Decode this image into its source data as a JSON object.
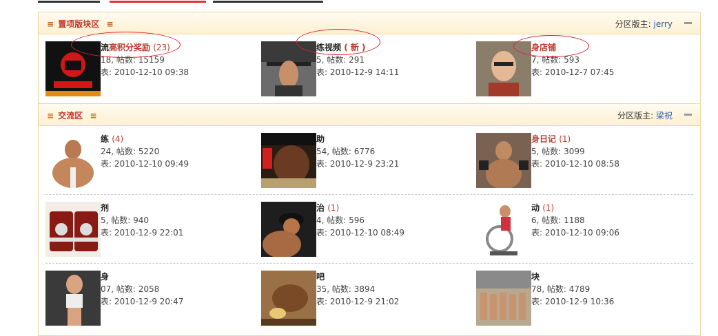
{
  "sections": [
    {
      "title": "置项版块区",
      "moderator_label": "分区版主:",
      "moderator": "jerry",
      "rows": [
        [
          {
            "name": "流",
            "name_red": "高积分奖励",
            "badge": "(23)",
            "stat": "18, 帖数: 15159",
            "last": "表: 2010-12-10 09:38",
            "thumb": "logo"
          },
          {
            "name": "练视频",
            "name_red": "",
            "badge": "( 新 )",
            "stat": "5, 帖数: 291",
            "last": "表: 2010-12-9 14:11",
            "thumb": "gym"
          },
          {
            "name": "",
            "name_red": "身店铺",
            "badge": "",
            "stat": "7, 帖数: 593",
            "last": "表: 2010-12-7 07:45",
            "thumb": "face"
          }
        ]
      ]
    },
    {
      "title": "交流区",
      "moderator_label": "分区版主:",
      "moderator": "梁祝",
      "rows": [
        [
          {
            "name": "练",
            "name_red": "",
            "badge": "(4)",
            "stat": "24, 帖数: 5220",
            "last": "表: 2010-12-10 09:49",
            "thumb": "muscle"
          },
          {
            "name": "助",
            "name_red": "",
            "badge": "",
            "stat": "54, 帖数: 6776",
            "last": "表: 2010-12-9 23:21",
            "thumb": "flex"
          },
          {
            "name": "",
            "name_red": "身日记",
            "badge": "(1)",
            "stat": "5, 帖数: 3099",
            "last": "表: 2010-12-10 08:58",
            "thumb": "man"
          }
        ],
        [
          {
            "name": "剂",
            "name_red": "",
            "badge": "",
            "stat": "5, 帖数: 940",
            "last": "表: 2010-12-9 22:01",
            "thumb": "tubs"
          },
          {
            "name": "治",
            "name_red": "",
            "badge": "(1)",
            "stat": "4, 帖数: 596",
            "last": "表: 2010-12-10 08:49",
            "thumb": "shoulder"
          },
          {
            "name": "动",
            "name_red": "",
            "badge": "(1)",
            "stat": "6, 帖数: 1188",
            "last": "表: 2010-12-10 09:06",
            "thumb": "bike"
          }
        ],
        [
          {
            "name": "身",
            "name_red": "",
            "badge": "",
            "stat": "07, 帖数: 2058",
            "last": "表: 2010-12-9 20:47",
            "thumb": "woman"
          },
          {
            "name": "吧",
            "name_red": "",
            "badge": "",
            "stat": "35, 帖数: 3894",
            "last": "表: 2010-12-9 21:02",
            "thumb": "tea"
          },
          {
            "name": "块",
            "name_red": "",
            "badge": "",
            "stat": "78, 帖数: 4789",
            "last": "表: 2010-12-9 10:36",
            "thumb": "group"
          }
        ]
      ]
    }
  ],
  "colors": {
    "accent": "#c0392b",
    "border": "#efd7a3",
    "link": "#2a5ca8"
  }
}
